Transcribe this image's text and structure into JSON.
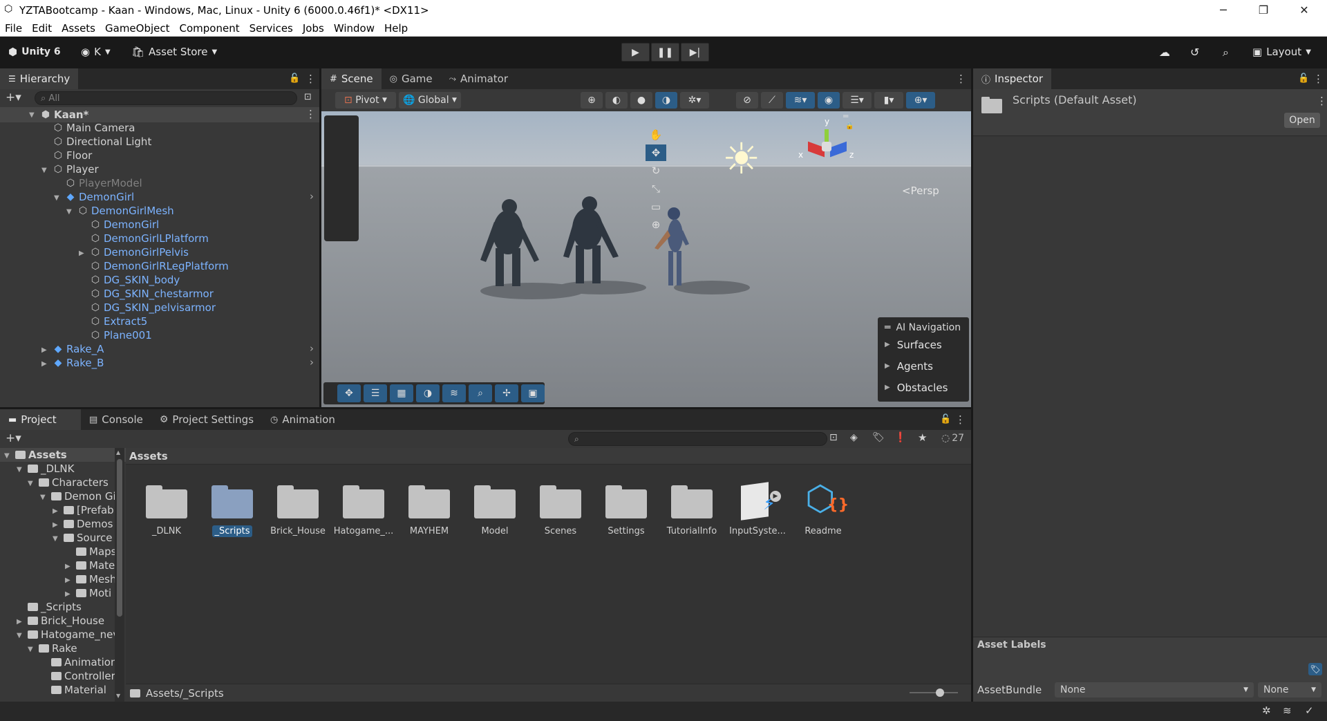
{
  "window": {
    "title": "YZTABootcamp - Kaan - Windows, Mac, Linux - Unity 6 (6000.0.46f1)* <DX11>"
  },
  "menu": [
    "File",
    "Edit",
    "Assets",
    "GameObject",
    "Component",
    "Services",
    "Jobs",
    "Window",
    "Help"
  ],
  "toolbar": {
    "account_label": "Unity 6",
    "user_label": "K",
    "asset_store_label": "Asset Store",
    "layout_label": "Layout"
  },
  "hierarchy": {
    "tab_label": "Hierarchy",
    "search_placeholder": "All",
    "scene_name": "Kaan*",
    "items": [
      "Main Camera",
      "Directional Light",
      "Floor",
      "Player",
      "PlayerModel",
      "DemonGirl",
      "DemonGirlMesh",
      "DemonGirl",
      "DemonGirlLPlatform",
      "DemonGirlPelvis",
      "DemonGirlRLegPlatform",
      "DG_SKIN_body",
      "DG_SKIN_chestarmor",
      "DG_SKIN_pelvisarmor",
      "Extract5",
      "Plane001",
      "Rake_A",
      "Rake_B"
    ]
  },
  "scene_tabs": [
    "Scene",
    "Game",
    "Animator"
  ],
  "scene_toolbar": {
    "pivot_label": "Pivot",
    "global_label": "Global"
  },
  "gizmo": {
    "y": "y",
    "x": "x",
    "z": "z",
    "persp_label": "Persp"
  },
  "ai_navigation": {
    "title": "AI Navigation",
    "items": [
      "Surfaces",
      "Agents",
      "Obstacles"
    ]
  },
  "inspector": {
    "tab_label": "Inspector",
    "title": "Scripts (Default Asset)",
    "open_label": "Open",
    "asset_labels_title": "Asset Labels",
    "assetbundle_label": "AssetBundle",
    "bundle_value": "None",
    "variant_value": "None"
  },
  "project_tabs": [
    "Project",
    "Console",
    "Project Settings",
    "Animation"
  ],
  "project": {
    "hidden_count": "27",
    "header": "Assets",
    "path": "Assets/_Scripts",
    "tree": [
      "Assets",
      "_DLNK",
      "Characters",
      "Demon Gi",
      "[Prefab",
      "Demos",
      "Source",
      "Maps",
      "Mate",
      "Mesh",
      "Moti",
      "_Scripts",
      "Brick_House",
      "Hatogame_nev",
      "Rake",
      "Animation",
      "Controller",
      "Material"
    ],
    "assets": [
      "_DLNK",
      "_Scripts",
      "Brick_House",
      "Hatogame_...",
      "MAYHEM",
      "Model",
      "Scenes",
      "Settings",
      "TutorialInfo",
      "InputSyste...",
      "Readme"
    ]
  },
  "colors": {
    "selection": "#2c5d87",
    "prefab_blue": "#7cb3ff",
    "panel": "#383838"
  }
}
